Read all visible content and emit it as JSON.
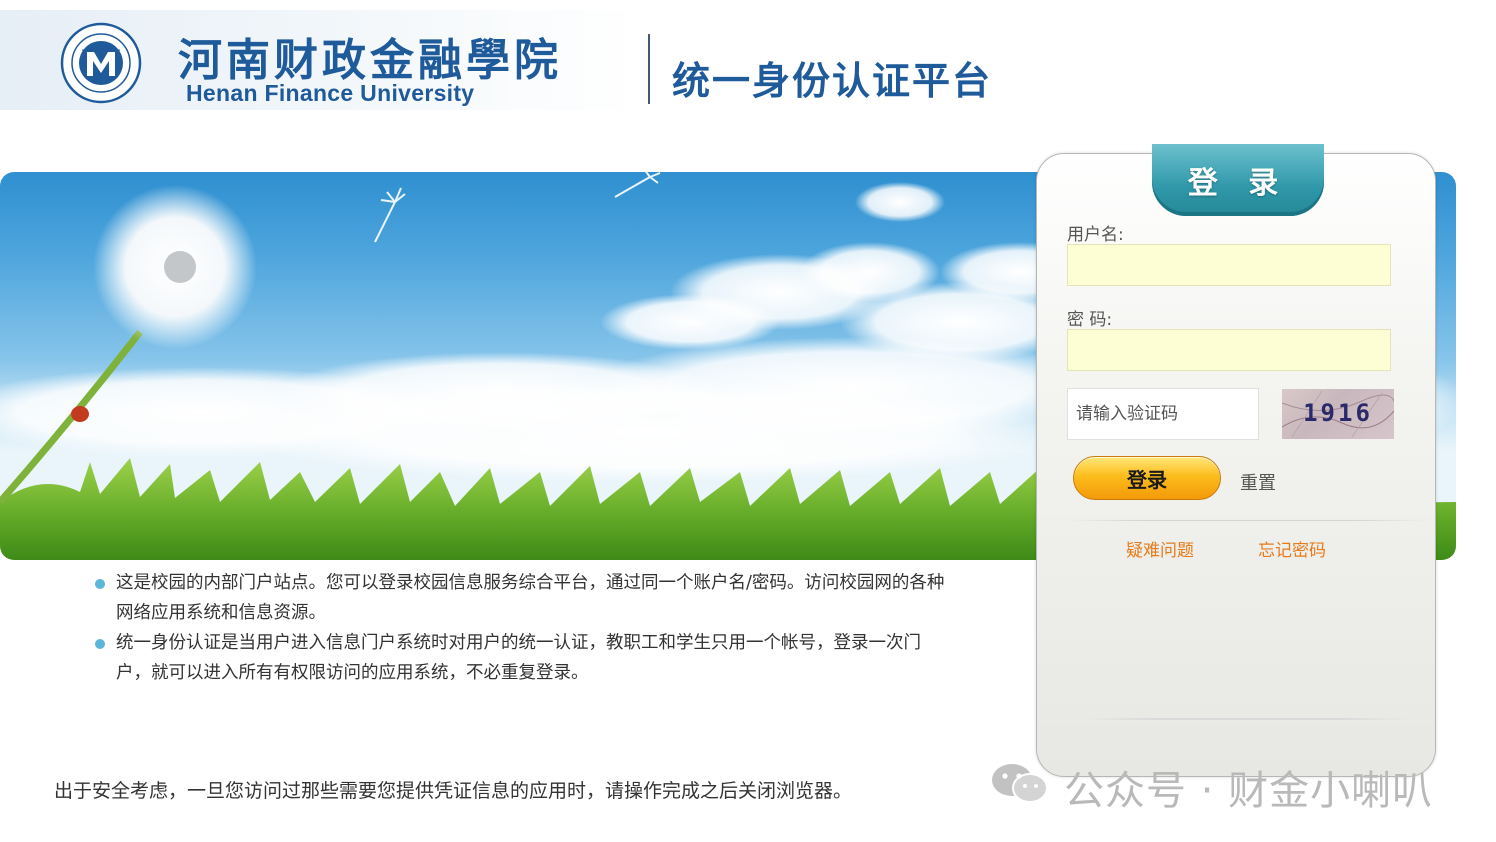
{
  "header": {
    "school_name_cn": "河南财政金融學院",
    "school_name_en": "Henan Finance University",
    "platform_title": "统一身份认证平台"
  },
  "info": {
    "items": [
      "这是校园的内部门户站点。您可以登录校园信息服务综合平台，通过同一个账户名/密码。访问校园网的各种网络应用系统和信息资源。",
      "统一身份认证是当用户进入信息门户系统时对用户的统一认证，教职工和学生只用一个帐号，登录一次门户，就可以进入所有有权限访问的应用系统，不必重复登录。"
    ],
    "security_note": "出于安全考虑，一旦您访问过那些需要您提供凭证信息的应用时，请操作完成之后关闭浏览器。"
  },
  "login": {
    "tab_title": "登 录",
    "username_label": "用户名:",
    "username_value": "",
    "password_label": "密 码:",
    "password_value": "",
    "captcha_placeholder": "请输入验证码",
    "captcha_code": "1916",
    "login_button": "登录",
    "reset_link": "重置",
    "help_link": "疑难问题",
    "forgot_link": "忘记密码"
  },
  "watermark": {
    "text": "公众号 · 财金小喇叭",
    "icon": "wechat-icon"
  },
  "colors": {
    "brand_blue": "#1f5a9a",
    "tab_teal": "#2f98aa",
    "button_orange": "#fcbd1c",
    "link_orange": "#e77b1b",
    "input_yellow": "#fefed4"
  }
}
